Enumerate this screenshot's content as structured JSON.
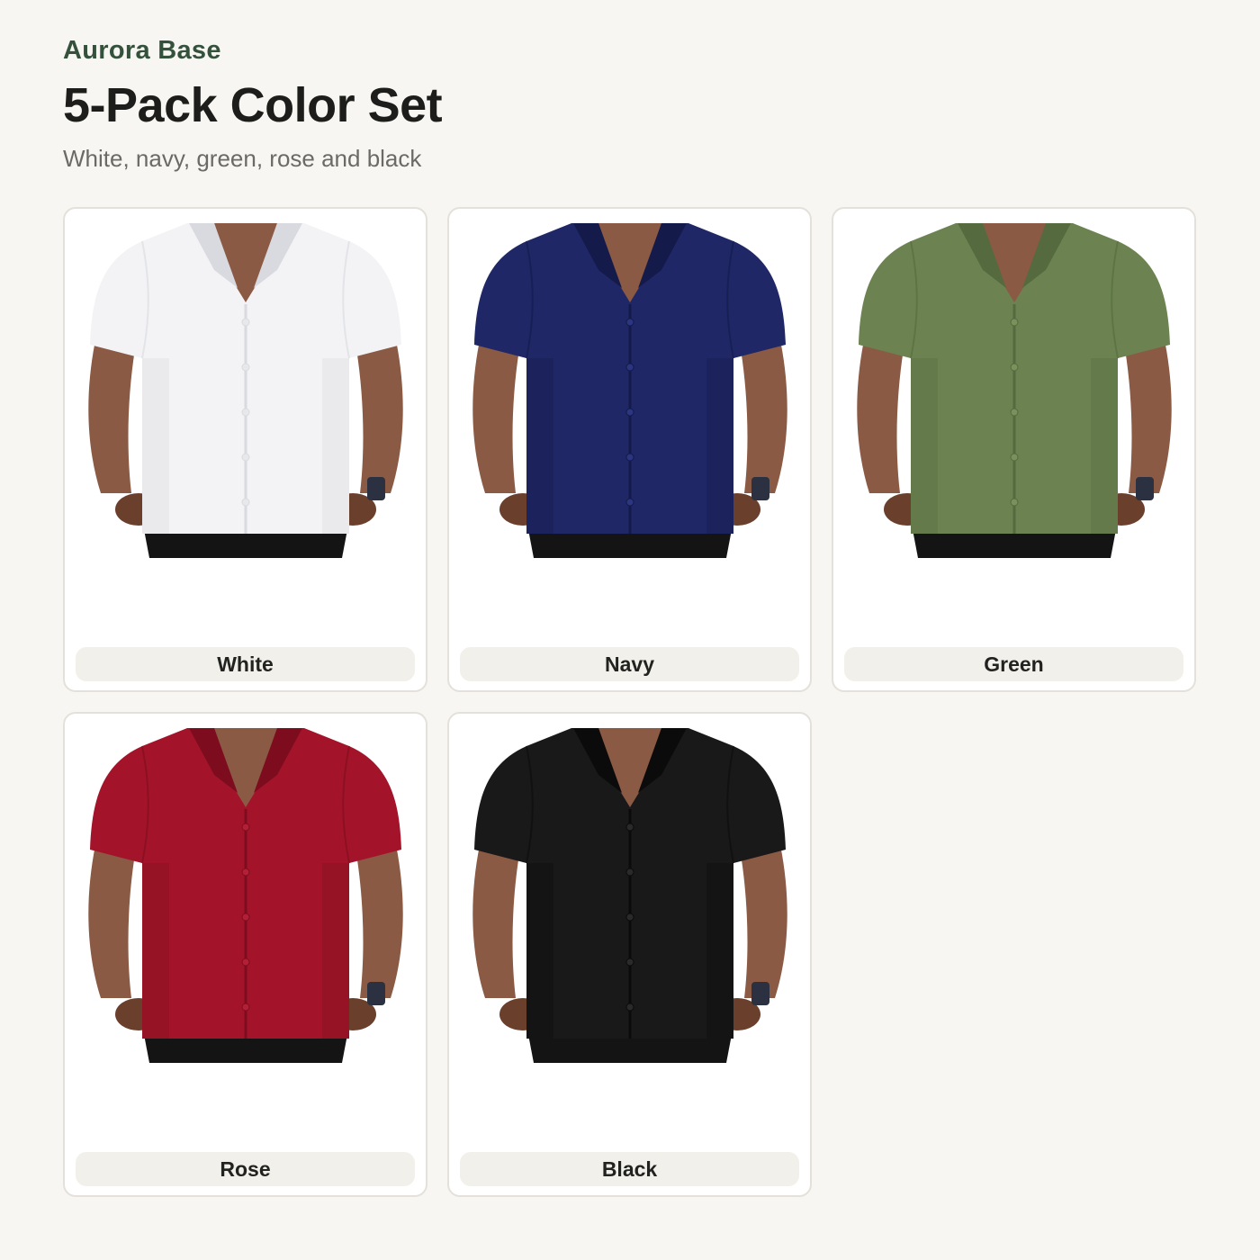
{
  "header": {
    "brand": "Aurora Base",
    "title": "5-Pack Color Set",
    "subtitle": "White, navy, green, rose and black"
  },
  "variants": [
    {
      "label": "White",
      "shirt_color": "#f3f3f5",
      "shirt_shade": "#d9dadf",
      "button_color": "#e8e8ec"
    },
    {
      "label": "Navy",
      "shirt_color": "#1f2766",
      "shirt_shade": "#141a4a",
      "button_color": "#2c3680"
    },
    {
      "label": "Green",
      "shirt_color": "#6c8351",
      "shirt_shade": "#556a3e",
      "button_color": "#7a905d"
    },
    {
      "label": "Rose",
      "shirt_color": "#a3142a",
      "shirt_shade": "#7d0d1e",
      "button_color": "#b31f36"
    },
    {
      "label": "Black",
      "shirt_color": "#191919",
      "shirt_shade": "#0b0b0b",
      "button_color": "#2a2a2a"
    }
  ],
  "colors": {
    "skin": "#8a5a44",
    "skin_shade": "#6a3f2c",
    "pants": "#141414",
    "accent_brand": "#34513c"
  }
}
